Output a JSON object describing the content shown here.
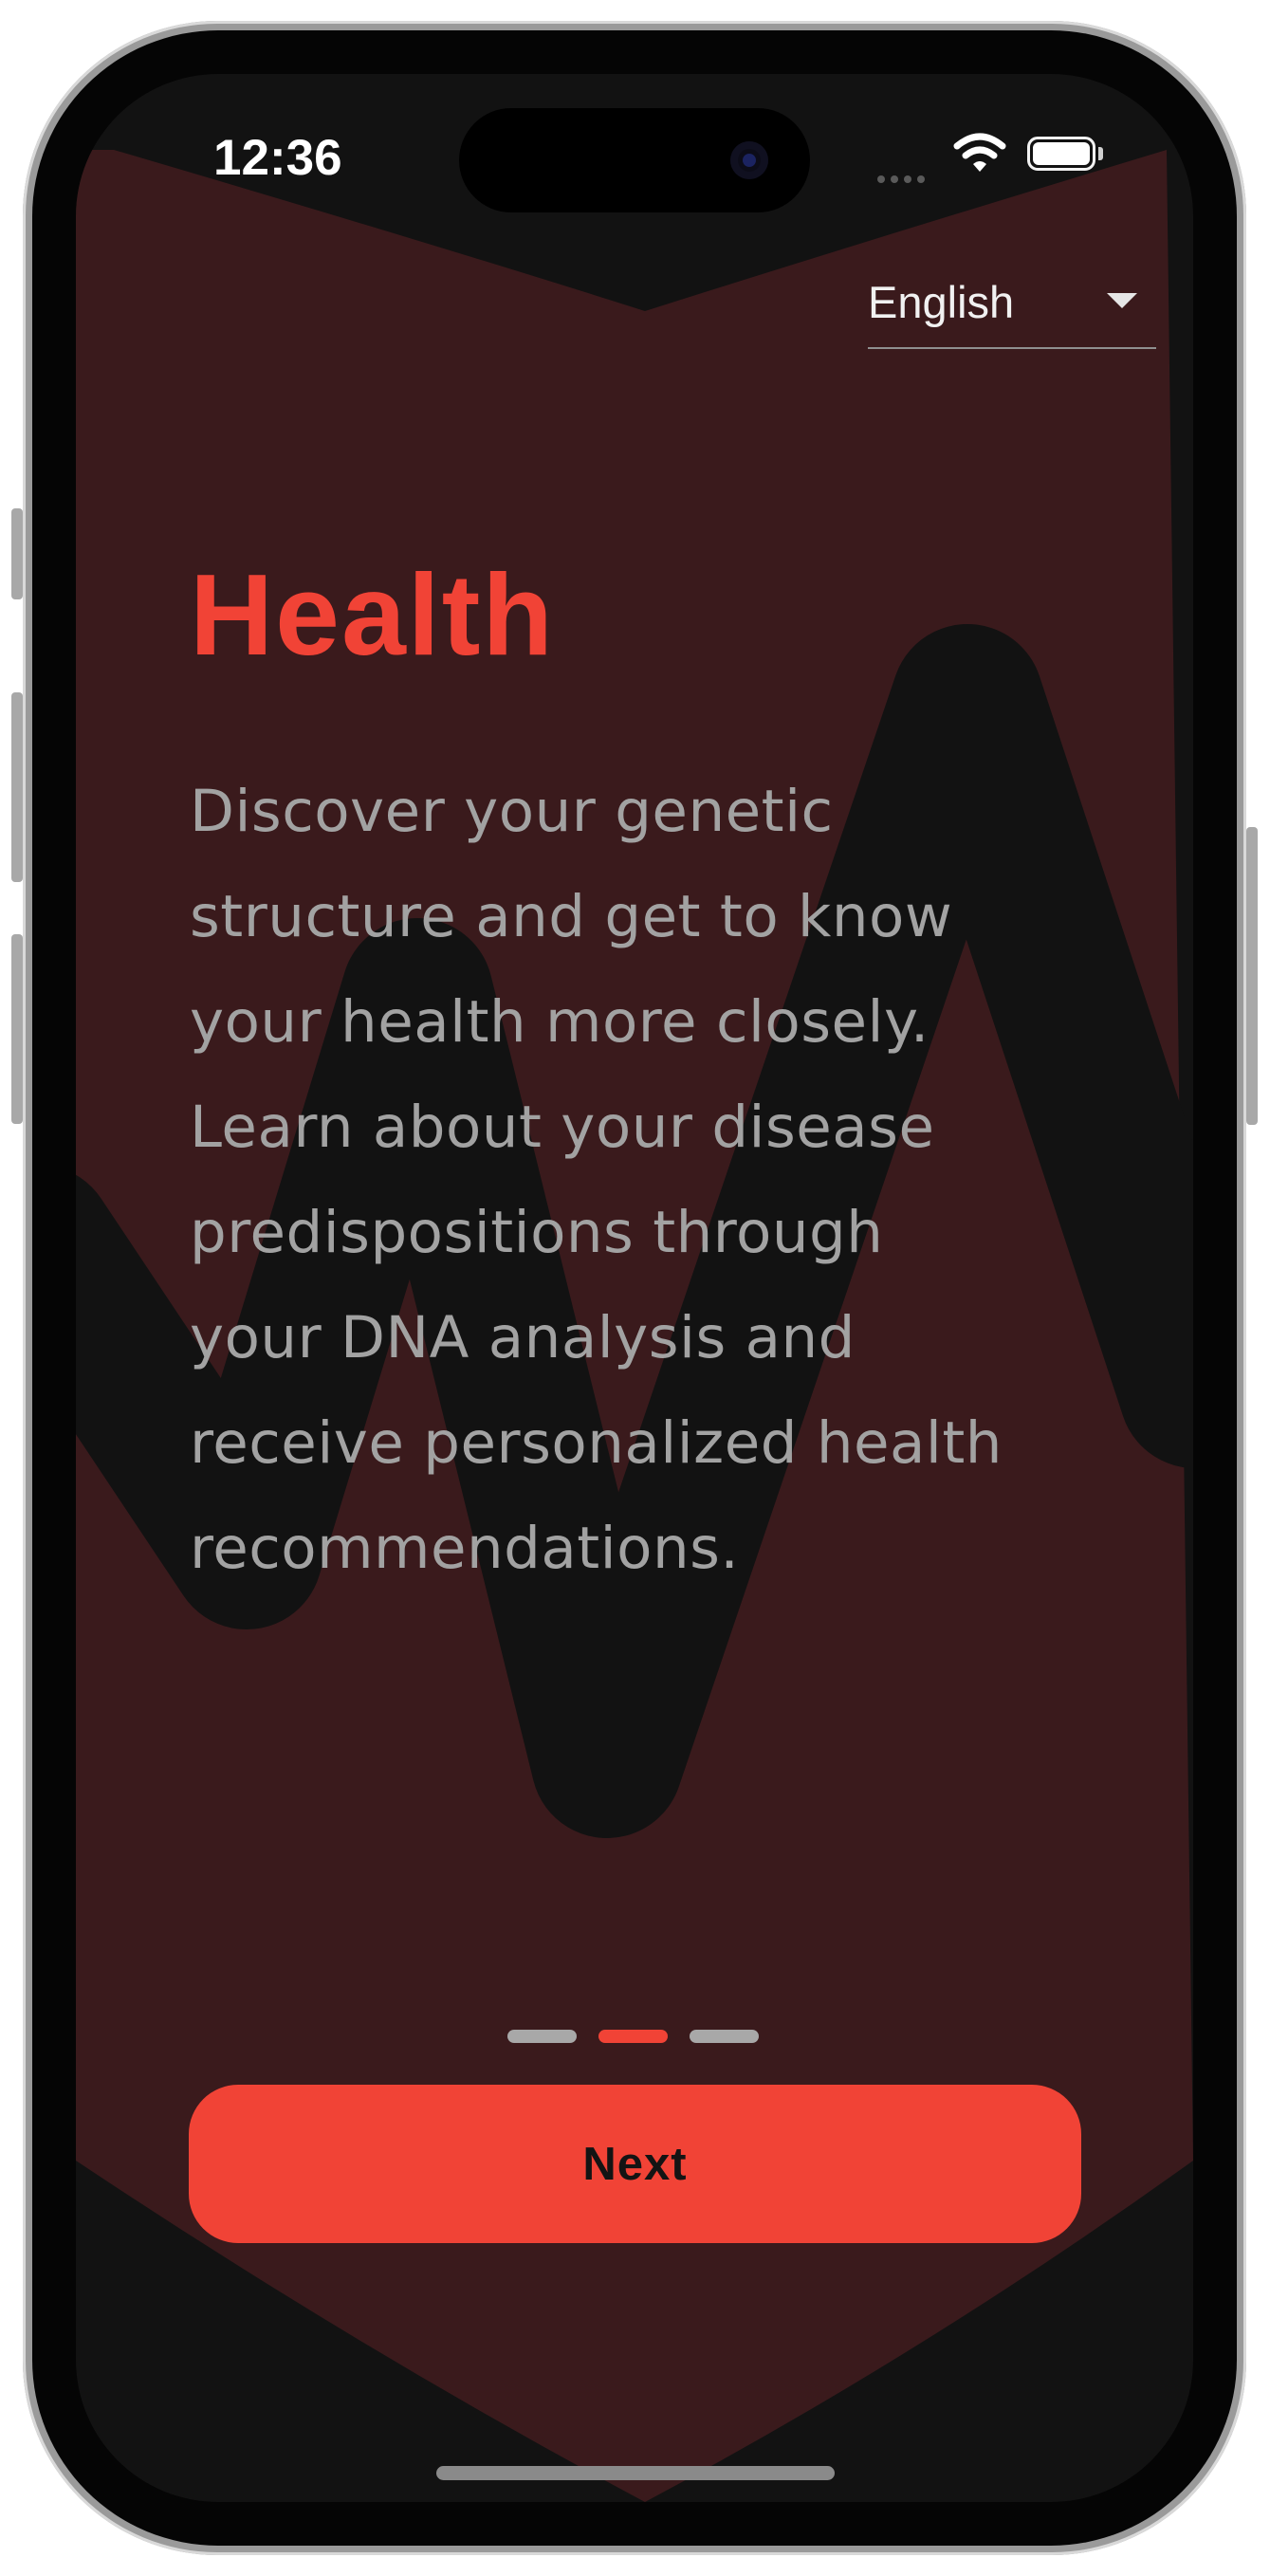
{
  "status_bar": {
    "time": "12:36"
  },
  "language_selector": {
    "selected": "English"
  },
  "onboarding": {
    "title": "Health",
    "body_lines": [
      "Discover your genetic",
      "structure and get to know",
      "your health more closely.",
      "Learn about your disease",
      "predispositions through",
      "your DNA analysis and",
      "receive personalized health",
      "recommendations."
    ],
    "page_count": 3,
    "active_page": 2,
    "next_label": "Next"
  },
  "colors": {
    "accent": "#f14336",
    "background": "#121212",
    "heart": "#3a1a1c",
    "text_muted": "#a2a2a2"
  },
  "icons": [
    "wifi-icon",
    "battery-icon",
    "signal-icon",
    "chevron-down-icon"
  ]
}
